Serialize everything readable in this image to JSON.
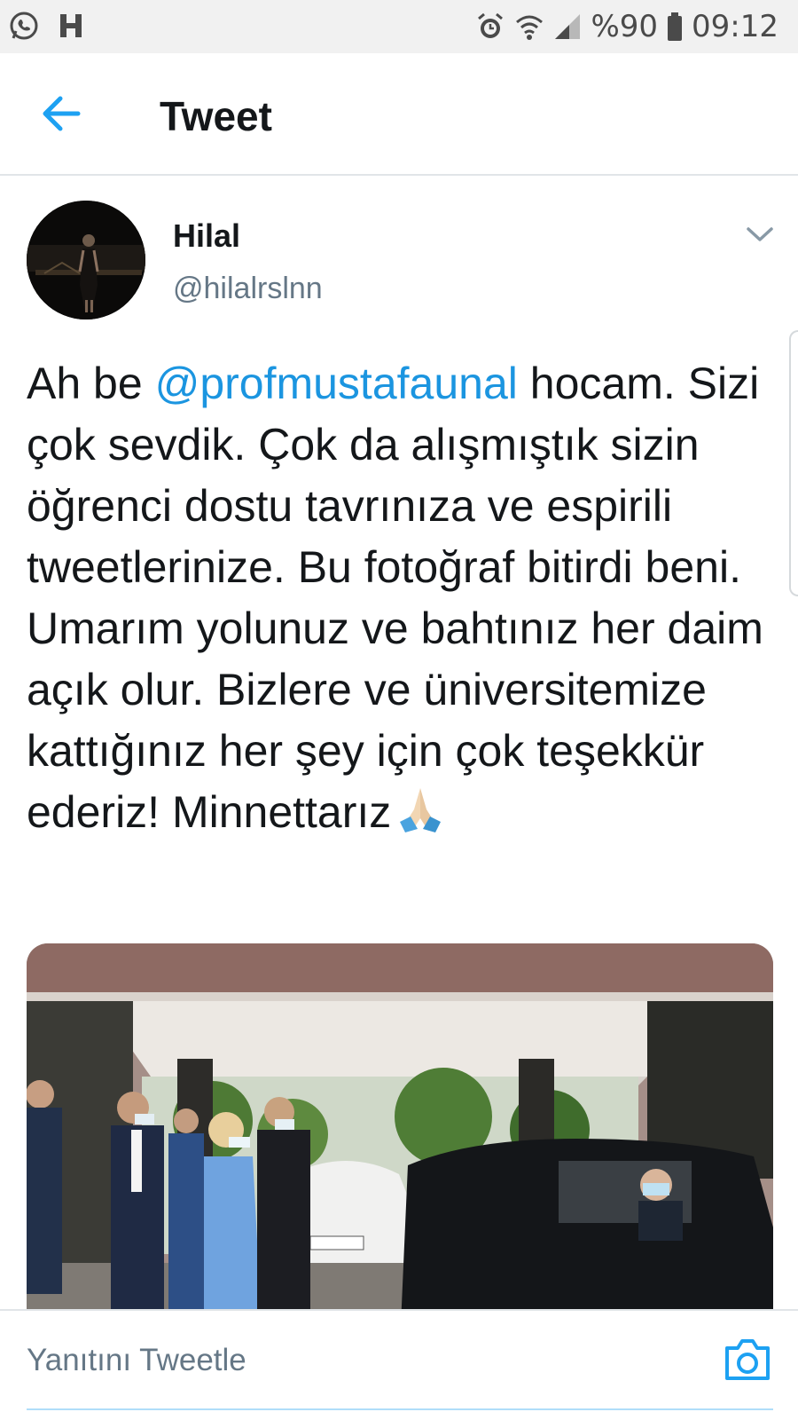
{
  "status_bar": {
    "battery_text": "%90",
    "time": "09:12",
    "left_icons": [
      "whatsapp-icon",
      "h-app-icon"
    ],
    "right_icons": [
      "alarm-icon",
      "wifi-icon",
      "signal-icon",
      "battery-icon"
    ]
  },
  "header": {
    "title": "Tweet"
  },
  "tweet": {
    "author_name": "Hilal",
    "author_handle": "@hilalrslnn",
    "text_before": "Ah be ",
    "mention": "@profmustafaunal",
    "text_after": " hocam. Sizi çok sevdik. Çok da alışmıştık sizin öğrenci dostu tavrınıza ve espirili tweetlerinize. Bu fotoğraf bitirdi beni. Umarım yolunuz ve bahtınız her daim açık olur. Bizlere ve üniversitemize kattığınız her şey için çok teşekkür ederiz! Minnettarız",
    "emoji": "folded-hands-emoji"
  },
  "reply": {
    "placeholder": "Yanıtını Tweetle"
  },
  "colors": {
    "accent": "#1da1f2",
    "mention": "#1b95e0",
    "secondary_text": "#657786",
    "status_bar_bg": "#f1f1f1"
  }
}
